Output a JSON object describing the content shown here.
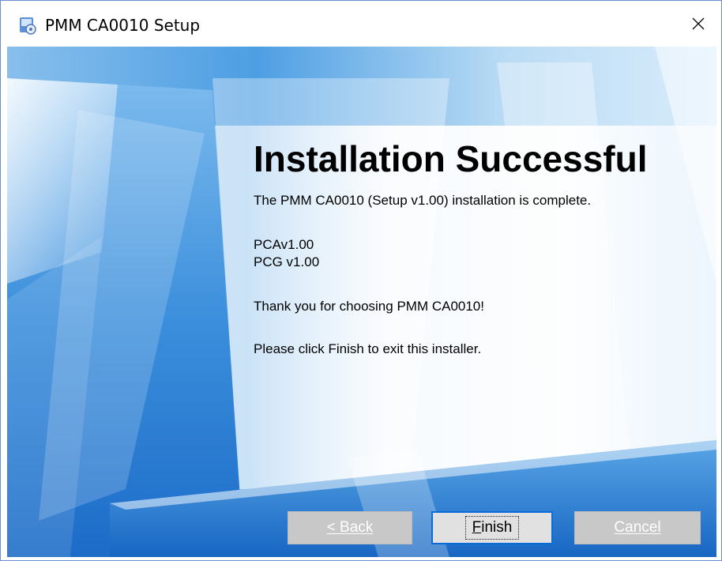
{
  "window": {
    "title": "PMM CA0010 Setup",
    "title_icon": "installer-icon",
    "close_icon": "close-icon"
  },
  "main": {
    "heading": "Installation Successful",
    "message": "The PMM CA0010 (Setup v1.00)  installation is complete.",
    "components": [
      "PCAv1.00",
      "PCG v1.00"
    ],
    "thanks": "Thank you for choosing PMM CA0010!",
    "instruction": "Please click Finish to exit this installer."
  },
  "buttons": {
    "back_label": "< Back",
    "finish_accel": "F",
    "finish_rest": "inish",
    "cancel_label": "Cancel"
  },
  "colors": {
    "accent": "#0a6cd8",
    "background": "#8fc0ea"
  }
}
